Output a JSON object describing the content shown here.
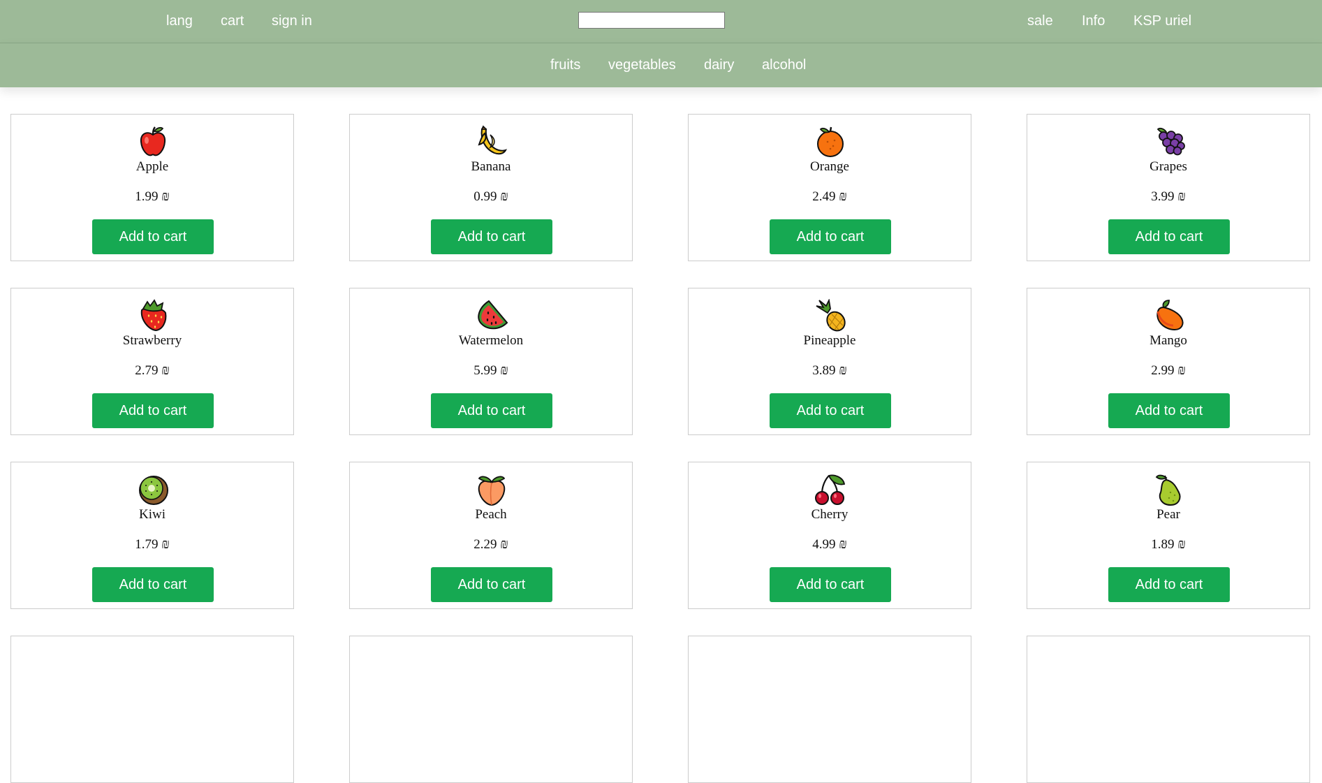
{
  "nav": {
    "lang": "lang",
    "cart": "cart",
    "sign_in": "sign in",
    "sale": "sale",
    "info": "Info",
    "user": "KSP uriel"
  },
  "search": {
    "value": "",
    "placeholder": ""
  },
  "categories": [
    "fruits",
    "vegetables",
    "dairy",
    "alcohol"
  ],
  "colors": {
    "bar": "#9dba98",
    "button": "#16a952"
  },
  "products": [
    {
      "name": "Apple",
      "price": "1.99 ₪",
      "icon": "apple-icon",
      "button": "Add to cart"
    },
    {
      "name": "Banana",
      "price": "0.99 ₪",
      "icon": "banana-icon",
      "button": "Add to cart"
    },
    {
      "name": "Orange",
      "price": "2.49 ₪",
      "icon": "orange-icon",
      "button": "Add to cart"
    },
    {
      "name": "Grapes",
      "price": "3.99 ₪",
      "icon": "grapes-icon",
      "button": "Add to cart"
    },
    {
      "name": "Strawberry",
      "price": "2.79 ₪",
      "icon": "strawberry-icon",
      "button": "Add to cart"
    },
    {
      "name": "Watermelon",
      "price": "5.99 ₪",
      "icon": "watermelon-icon",
      "button": "Add to cart"
    },
    {
      "name": "Pineapple",
      "price": "3.89 ₪",
      "icon": "pineapple-icon",
      "button": "Add to cart"
    },
    {
      "name": "Mango",
      "price": "2.99 ₪",
      "icon": "mango-icon",
      "button": "Add to cart"
    },
    {
      "name": "Kiwi",
      "price": "1.79 ₪",
      "icon": "kiwi-icon",
      "button": "Add to cart"
    },
    {
      "name": "Peach",
      "price": "2.29 ₪",
      "icon": "peach-icon",
      "button": "Add to cart"
    },
    {
      "name": "Cherry",
      "price": "4.99 ₪",
      "icon": "cherry-icon",
      "button": "Add to cart"
    },
    {
      "name": "Pear",
      "price": "1.89 ₪",
      "icon": "pear-icon",
      "button": "Add to cart"
    }
  ]
}
